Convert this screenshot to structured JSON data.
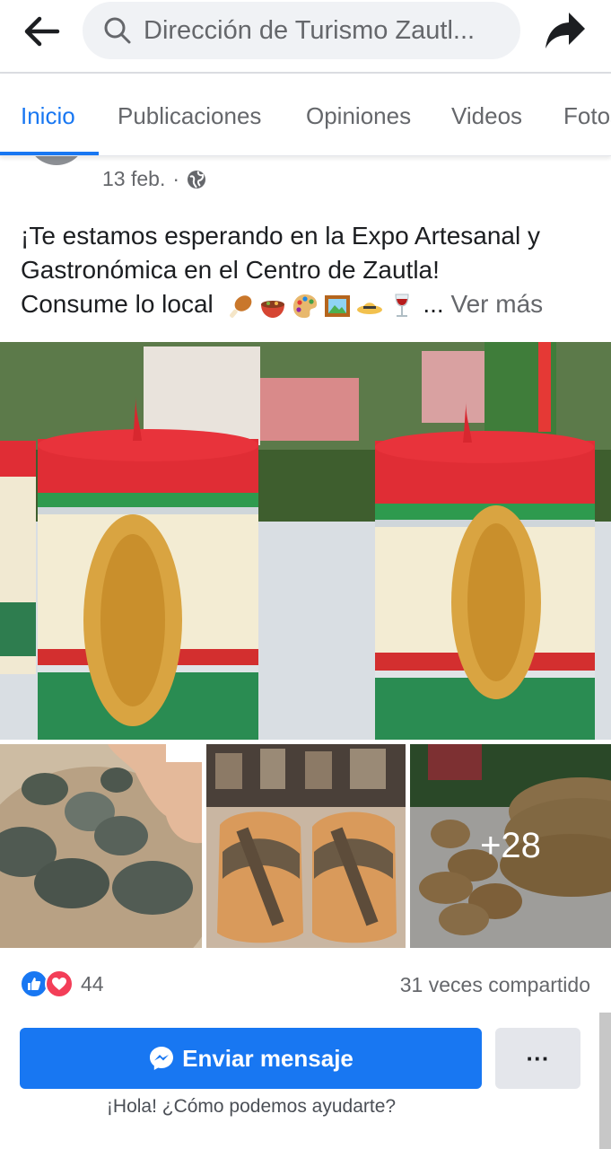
{
  "topbar": {
    "back_icon": "arrow-left-icon",
    "search_icon": "search-icon",
    "search_value": "Dirección de Turismo Zautl...",
    "share_icon": "share-arrow-icon"
  },
  "tabs": [
    {
      "label": "Inicio",
      "active": true
    },
    {
      "label": "Publicaciones",
      "active": false
    },
    {
      "label": "Opiniones",
      "active": false
    },
    {
      "label": "Videos",
      "active": false
    },
    {
      "label": "Fotos",
      "active": false
    }
  ],
  "post": {
    "date": "13 feb.",
    "separator": "·",
    "privacy_icon": "globe-icon",
    "text_line1": "¡Te estamos esperando en la Expo Artesanal y Gastronómica en el Centro de Zautla!",
    "text_line2": "Consume lo local",
    "emojis": [
      "drumstick-emoji",
      "stew-bowl-emoji",
      "palette-emoji",
      "framed-picture-emoji",
      "hat-emoji",
      "wine-glass-emoji"
    ],
    "ellipsis": "...",
    "see_more": "Ver más",
    "more_photos": "+28"
  },
  "engagement": {
    "reaction_icons": [
      "like-icon",
      "love-icon"
    ],
    "reaction_count": "44",
    "shares": "31 veces compartido"
  },
  "actions": {
    "message_label": "Enviar mensaje",
    "message_icon": "messenger-icon",
    "more_label": "···",
    "helper": "¡Hola! ¿Cómo podemos ayudarte?"
  },
  "colors": {
    "accent": "#1877f2",
    "text": "#1c1e21",
    "secondary_text": "#65676b",
    "love": "#f33e58"
  }
}
